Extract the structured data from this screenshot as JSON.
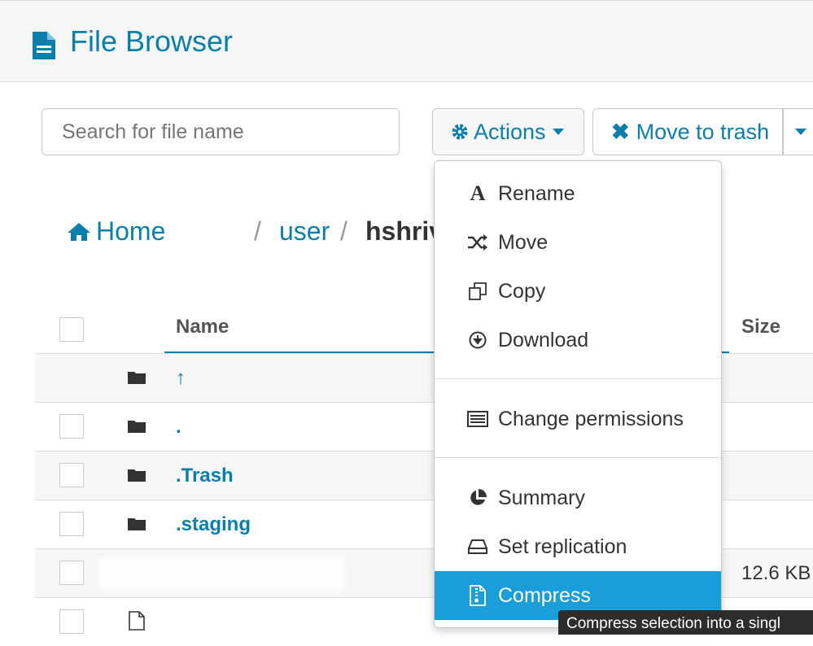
{
  "header": {
    "title": "File Browser",
    "icon": "file-text-icon",
    "accent": "#0b7fab"
  },
  "toolbar": {
    "search_placeholder": "Search for file name",
    "actions_label": "Actions",
    "trash_label": "Move to trash"
  },
  "breadcrumb": {
    "home": "Home",
    "sep1": "/",
    "user": "user",
    "sep2": "/",
    "current": "hshriv"
  },
  "table": {
    "col_name": "Name",
    "col_size": "Size",
    "rows": [
      {
        "name": "↑",
        "size": ""
      },
      {
        "name": ".",
        "size": ""
      },
      {
        "name": ".Trash",
        "size": ""
      },
      {
        "name": ".staging",
        "size": ""
      },
      {
        "name": "",
        "size": "12.6 KB"
      },
      {
        "name": "",
        "size": ""
      }
    ]
  },
  "menu": {
    "items": [
      {
        "label": "Rename",
        "icon": "font-icon"
      },
      {
        "label": "Move",
        "icon": "random-icon"
      },
      {
        "label": "Copy",
        "icon": "copy-icon"
      },
      {
        "label": "Download",
        "icon": "download-icon"
      },
      {
        "label": "Change permissions",
        "icon": "list-icon"
      },
      {
        "label": "Summary",
        "icon": "pie-chart-icon"
      },
      {
        "label": "Set replication",
        "icon": "hdd-icon"
      },
      {
        "label": "Compress",
        "icon": "file-zip-icon"
      }
    ],
    "highlight": "#1a9ed9"
  },
  "tooltip": {
    "text": "Compress selection into a singl"
  }
}
